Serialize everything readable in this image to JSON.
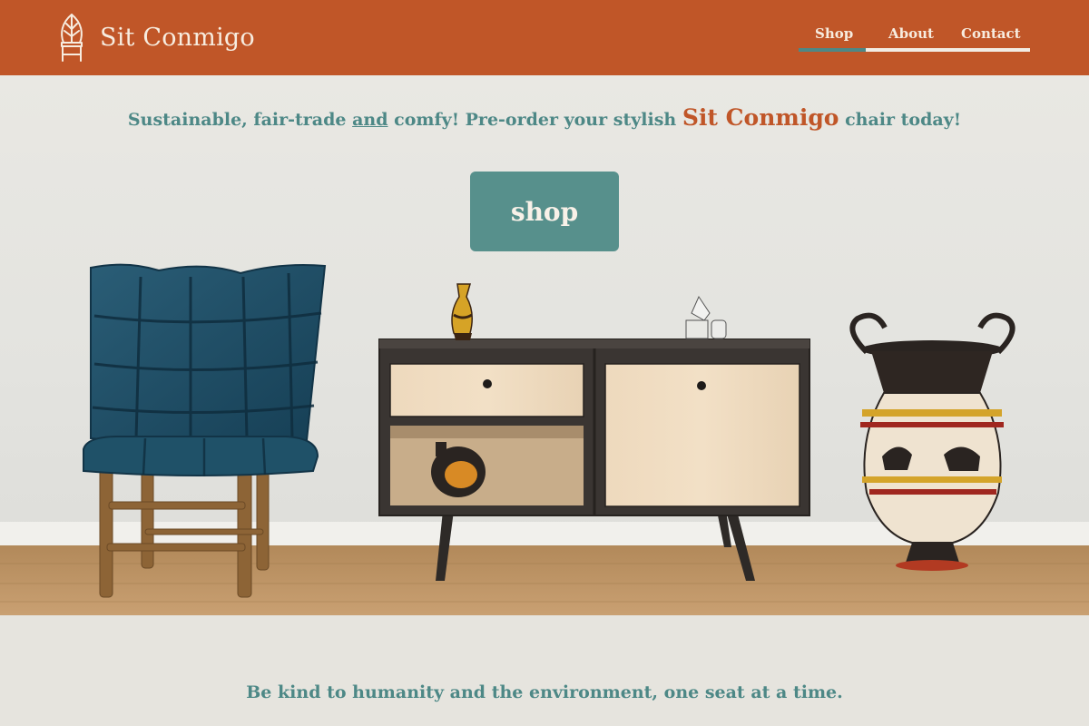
{
  "brand": {
    "name": "Sit Conmigo",
    "logo_icon": "chair-leaf-icon"
  },
  "nav": {
    "items": [
      {
        "label": "Shop",
        "active": true
      },
      {
        "label": "About",
        "active": false
      },
      {
        "label": "Contact",
        "active": false
      }
    ]
  },
  "hero": {
    "tagline_part1": "Sustainable, fair-trade ",
    "tagline_em": "and",
    "tagline_part2": " comfy! Pre-order your stylish ",
    "tagline_brand": "Sit Conmigo",
    "tagline_part3": " chair today!",
    "cta_label": "shop"
  },
  "footer": {
    "motto": "Be kind to humanity and the environment, one seat at a time."
  },
  "colors": {
    "header_bg": "#c05628",
    "accent_teal": "#4d8886",
    "button_bg": "#57908c",
    "page_bg": "#e6e4de",
    "header_text": "#f7ecdf"
  }
}
